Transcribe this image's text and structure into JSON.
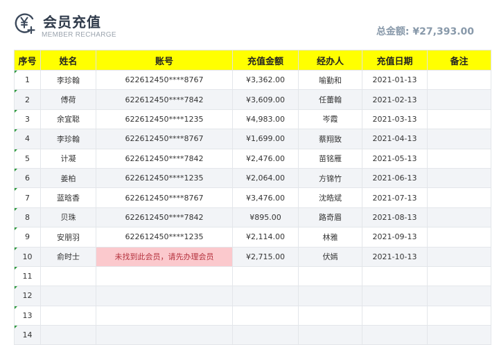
{
  "header": {
    "title": "会员充值",
    "subtitle": "MEMBER RECHARGE",
    "total_label": "总金额:",
    "total_value": "¥27,393.00",
    "logo_icon": "yen-plus-icon"
  },
  "columns": [
    "序号",
    "姓名",
    "账号",
    "充值金额",
    "经办人",
    "充值日期",
    "备注"
  ],
  "colors": {
    "header_bg": "#ffff00",
    "stripe_bg": "#f2f4f7",
    "warn_bg": "#fbc9cd",
    "warn_text": "#b5323e",
    "marker": "#2e9a3e"
  },
  "rows": [
    {
      "idx": "1",
      "name": "李珍翰",
      "account": "622612450****8767",
      "amount": "¥3,362.00",
      "agent": "喻勤和",
      "date": "2021-01-13",
      "note": ""
    },
    {
      "idx": "2",
      "name": "傅荷",
      "account": "622612450****7842",
      "amount": "¥3,609.00",
      "agent": "任蕾翰",
      "date": "2021-02-13",
      "note": ""
    },
    {
      "idx": "3",
      "name": "余宜聪",
      "account": "622612450****1235",
      "amount": "¥4,983.00",
      "agent": "岑霞",
      "date": "2021-03-13",
      "note": ""
    },
    {
      "idx": "4",
      "name": "李珍翰",
      "account": "622612450****8767",
      "amount": "¥1,699.00",
      "agent": "蔡翔致",
      "date": "2021-04-13",
      "note": ""
    },
    {
      "idx": "5",
      "name": "计凝",
      "account": "622612450****7842",
      "amount": "¥2,476.00",
      "agent": "苗铭雁",
      "date": "2021-05-13",
      "note": ""
    },
    {
      "idx": "6",
      "name": "姜柏",
      "account": "622612450****1235",
      "amount": "¥2,064.00",
      "agent": "方锦竹",
      "date": "2021-06-13",
      "note": ""
    },
    {
      "idx": "7",
      "name": "蓝晗香",
      "account": "622612450****8767",
      "amount": "¥3,476.00",
      "agent": "沈皓斌",
      "date": "2021-07-13",
      "note": ""
    },
    {
      "idx": "8",
      "name": "贝珠",
      "account": "622612450****7842",
      "amount": "¥895.00",
      "agent": "路奇眉",
      "date": "2021-08-13",
      "note": ""
    },
    {
      "idx": "9",
      "name": "安朋羽",
      "account": "622612450****1235",
      "amount": "¥2,114.00",
      "agent": "林雅",
      "date": "2021-09-13",
      "note": ""
    },
    {
      "idx": "10",
      "name": "俞时士",
      "account": "未找到此会员，请先办理会员",
      "account_warning": true,
      "amount": "¥2,715.00",
      "agent": "伏嫣",
      "date": "2021-10-13",
      "note": ""
    },
    {
      "idx": "11",
      "name": "",
      "account": "",
      "amount": "",
      "agent": "",
      "date": "",
      "note": ""
    },
    {
      "idx": "12",
      "name": "",
      "account": "",
      "amount": "",
      "agent": "",
      "date": "",
      "note": ""
    },
    {
      "idx": "13",
      "name": "",
      "account": "",
      "amount": "",
      "agent": "",
      "date": "",
      "note": ""
    },
    {
      "idx": "14",
      "name": "",
      "account": "",
      "amount": "",
      "agent": "",
      "date": "",
      "note": ""
    }
  ]
}
